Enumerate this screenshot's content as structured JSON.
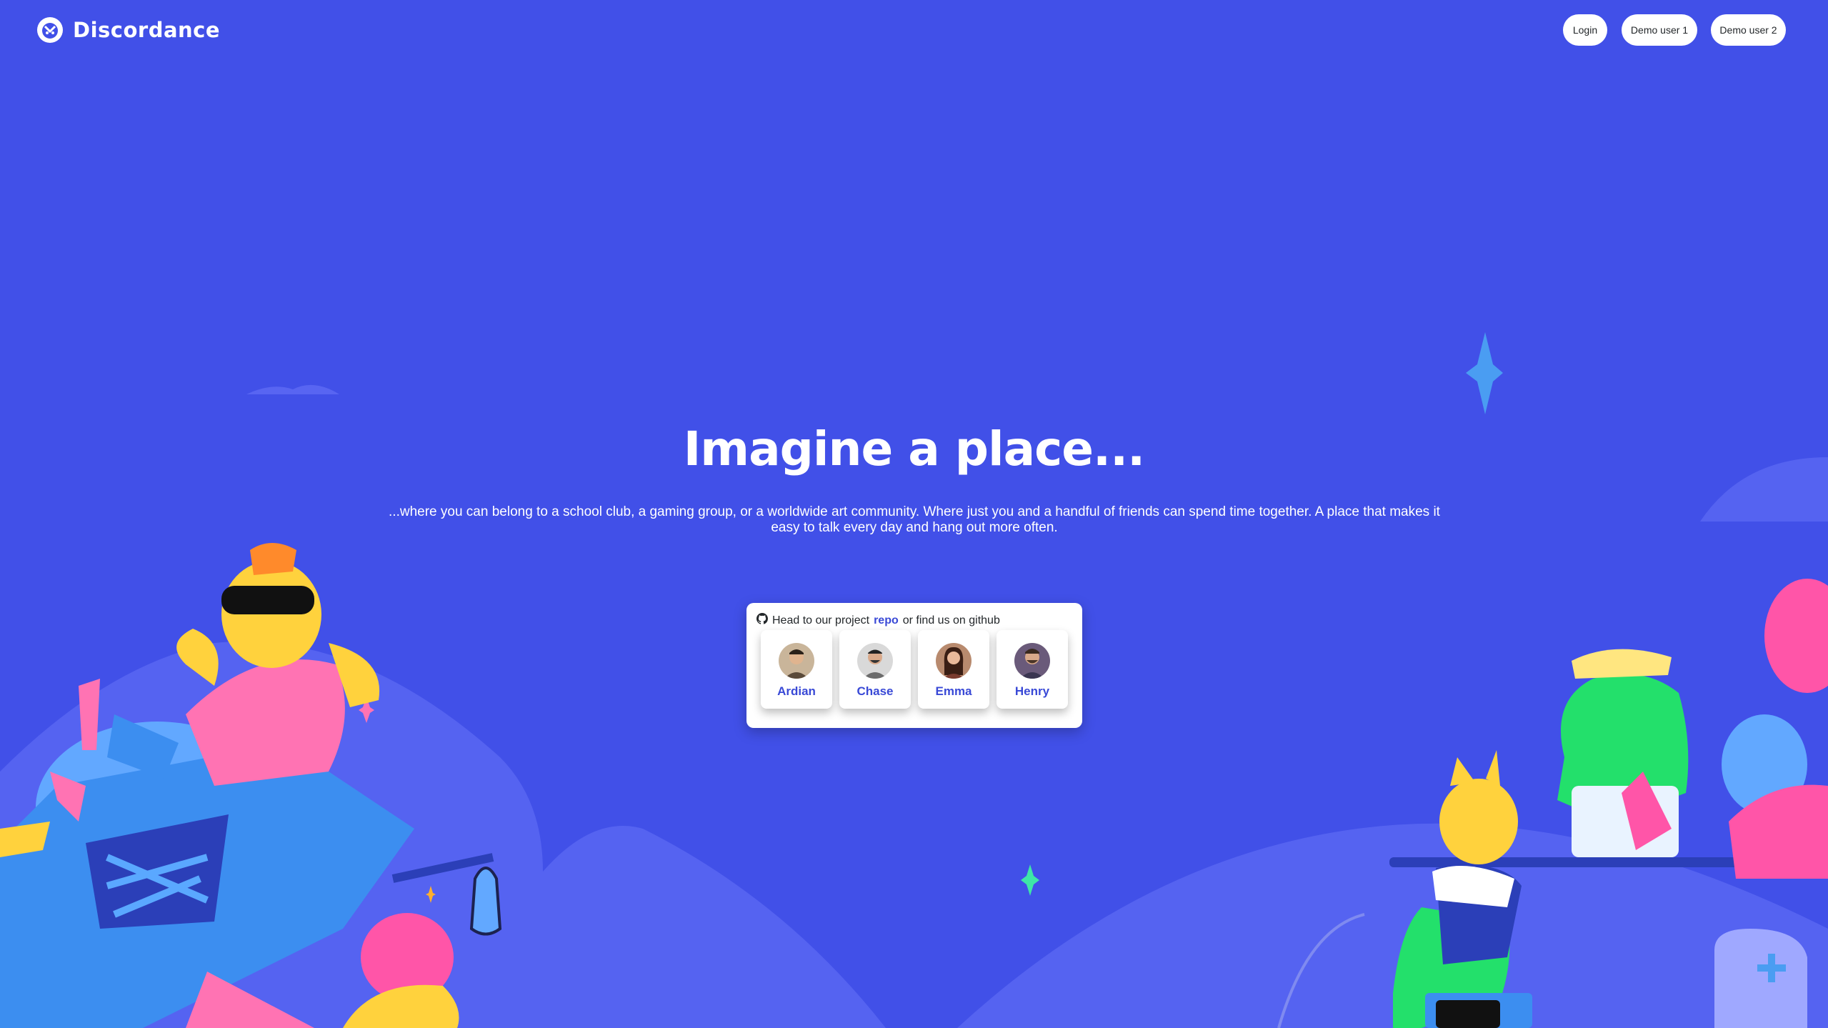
{
  "brand": {
    "name": "Discordance",
    "logo_icon": "discordance-logo-icon"
  },
  "nav": {
    "login_label": "Login",
    "demo1_label": "Demo user 1",
    "demo2_label": "Demo user 2"
  },
  "hero": {
    "title": "Imagine a place...",
    "subtitle": "...where you can belong to a school club, a gaming group, or a worldwide art community. Where just you and a handful of friends can spend time together. A place that makes it easy to talk every day and hang out more often."
  },
  "team_card": {
    "icon": "github-icon",
    "text_before": "Head to our project",
    "link_text": "repo",
    "text_after": "or find us on github",
    "members": [
      {
        "name": "Ardian",
        "color": "#5a4a3a"
      },
      {
        "name": "Chase",
        "color": "#6b6b6b"
      },
      {
        "name": "Emma",
        "color": "#7a3b2e"
      },
      {
        "name": "Henry",
        "color": "#3a3550"
      }
    ]
  },
  "colors": {
    "background": "#4150e8",
    "accent": "#3949d6"
  }
}
